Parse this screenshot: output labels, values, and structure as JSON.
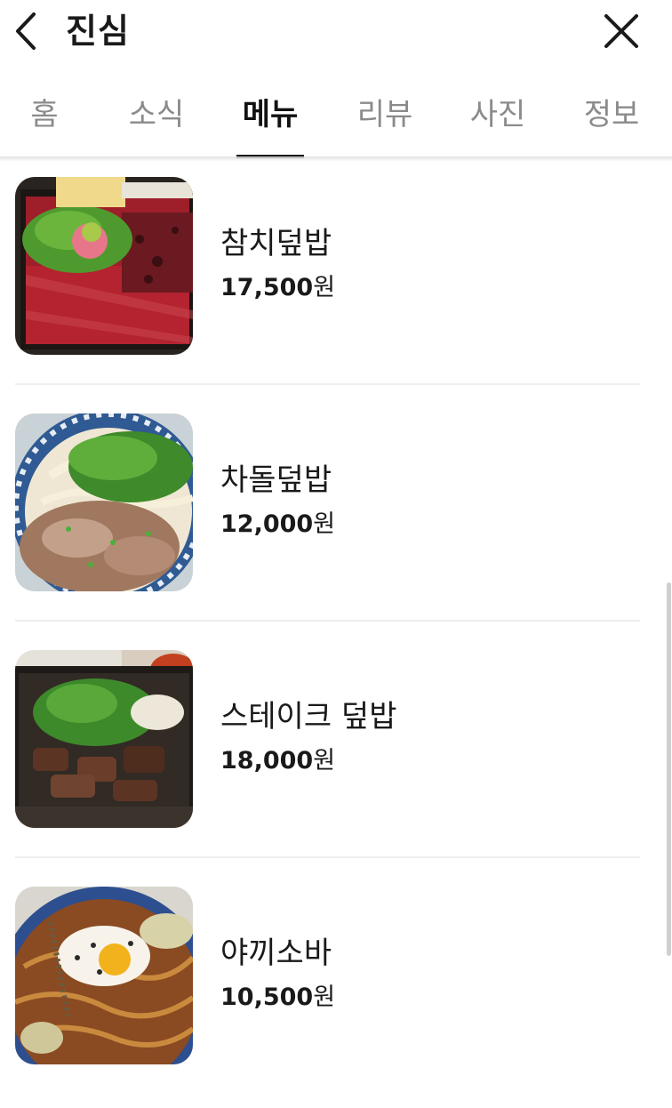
{
  "header": {
    "title": "진심"
  },
  "tabs": [
    {
      "label": "홈"
    },
    {
      "label": "소식"
    },
    {
      "label": "메뉴"
    },
    {
      "label": "리뷰"
    },
    {
      "label": "사진"
    },
    {
      "label": "정보"
    }
  ],
  "active_tab": "메뉴",
  "menu": [
    {
      "name": "참치덮밥",
      "price_number": "17,500",
      "price_unit": "원"
    },
    {
      "name": "차돌덮밥",
      "price_number": "12,000",
      "price_unit": "원"
    },
    {
      "name": "스테이크 덮밥",
      "price_number": "18,000",
      "price_unit": "원"
    },
    {
      "name": "야끼소바",
      "price_number": "10,500",
      "price_unit": "원"
    }
  ],
  "colors": {
    "text": "#1a1a1a",
    "inactive_tab": "#8b8b8b",
    "divider": "#efefef"
  }
}
